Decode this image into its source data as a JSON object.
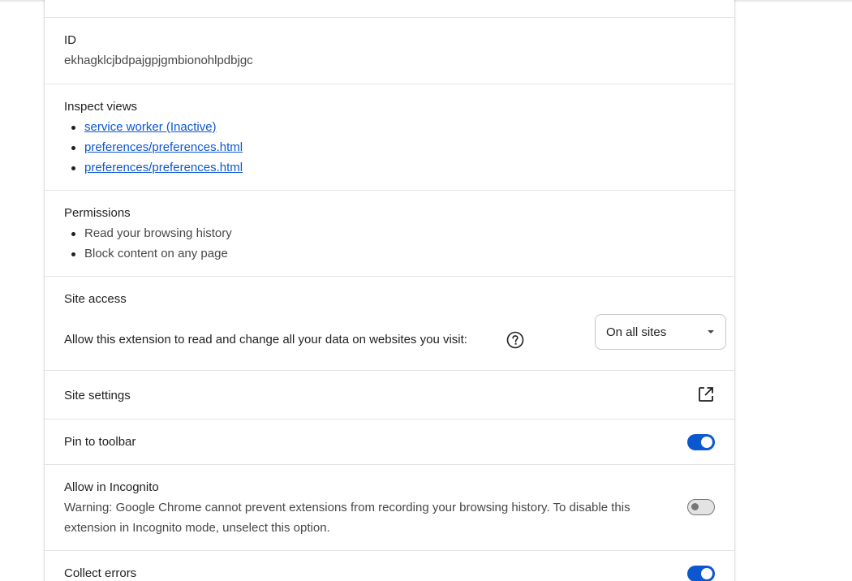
{
  "id_section": {
    "label": "ID",
    "value": "ekhagklcjbdpajgpjgmbionohlpdbjgc"
  },
  "inspect_views": {
    "label": "Inspect views",
    "links": [
      "service worker (Inactive)",
      "preferences/preferences.html",
      "preferences/preferences.html"
    ]
  },
  "permissions": {
    "label": "Permissions",
    "items": [
      "Read your browsing history",
      "Block content on any page"
    ]
  },
  "site_access": {
    "label": "Site access",
    "description": "Allow this extension to read and change all your data on websites you visit:",
    "help_icon": "help-circle-icon",
    "dropdown_value": "On all sites"
  },
  "site_settings": {
    "label": "Site settings",
    "icon": "open-in-new-icon"
  },
  "pin_to_toolbar": {
    "label": "Pin to toolbar",
    "enabled": true
  },
  "allow_incognito": {
    "label": "Allow in Incognito",
    "warning": "Warning: Google Chrome cannot prevent extensions from recording your browsing history. To disable this extension in Incognito mode, unselect this option.",
    "enabled": false
  },
  "collect_errors": {
    "label": "Collect errors",
    "enabled": true
  },
  "colors": {
    "accent": "#0b57d0",
    "text": "#1f1f1f",
    "secondary_text": "#474747",
    "divider": "#e3e3e3"
  }
}
